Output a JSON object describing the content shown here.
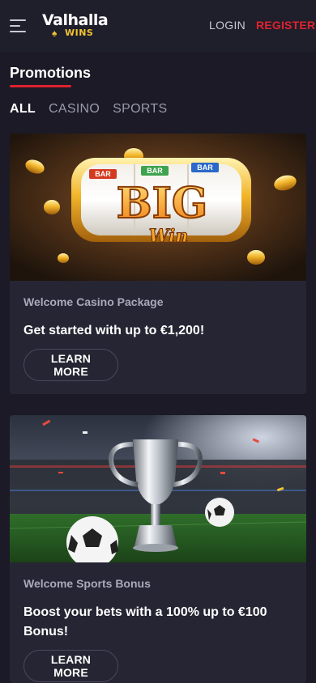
{
  "header": {
    "logo_main": "Valhalla",
    "logo_sub": "WINS",
    "login_label": "LOGIN",
    "register_label": "REGISTER"
  },
  "page": {
    "title": "Promotions"
  },
  "tabs": [
    {
      "label": "ALL",
      "active": true
    },
    {
      "label": "CASINO",
      "active": false
    },
    {
      "label": "SPORTS",
      "active": false
    }
  ],
  "promotions": [
    {
      "image": "big-win-slot-machine",
      "image_text_top": [
        "BAR",
        "BAR",
        "BAR"
      ],
      "image_text_big": "BIG",
      "image_text_win": "Win",
      "label": "Welcome Casino Package",
      "headline": "Get started with up to €1,200!",
      "button_label": "LEARN MORE"
    },
    {
      "image": "trophy-stadium-soccer-balls",
      "label": "Welcome Sports Bonus",
      "headline": "Boost your bets with a 100% up to €100 Bonus!",
      "button_label": "LEARN MORE"
    }
  ],
  "colors": {
    "background": "#1b1a26",
    "header": "#1f1e2b",
    "card": "#262533",
    "accent_red": "#e0222f",
    "logo_gold": "#f2c430"
  }
}
